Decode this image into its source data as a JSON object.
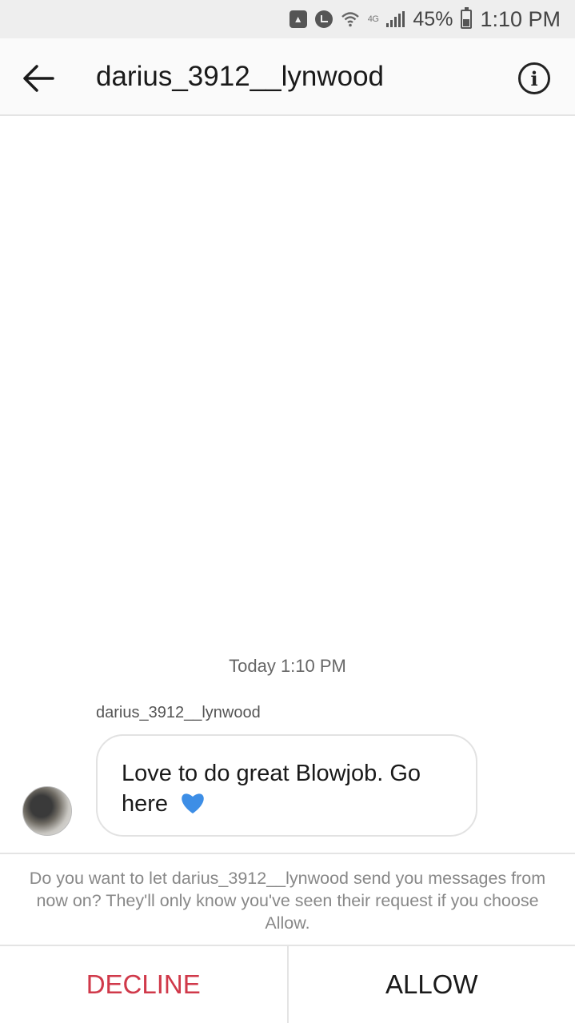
{
  "status_bar": {
    "lte_label": "4G",
    "battery_percent": "45%",
    "time": "1:10 PM",
    "icons": [
      "notification-icon",
      "alarm-icon",
      "wifi-icon",
      "signal-icon",
      "battery-icon"
    ]
  },
  "header": {
    "title": "darius_3912__lynwood",
    "back_icon": "arrow-left-icon",
    "info_icon": "info-icon"
  },
  "conversation": {
    "timestamp": "Today 1:10 PM",
    "sender": "darius_3912__lynwood",
    "message": {
      "text": "Love to do great Blowjob. Go here",
      "emoji": "blue-heart-icon"
    }
  },
  "request": {
    "prompt": "Do you want to let darius_3912__lynwood send you messages from now on? They'll only know you've seen their request if you choose Allow.",
    "decline_label": "DECLINE",
    "allow_label": "ALLOW"
  },
  "colors": {
    "decline": "#d0394a",
    "heart": "#3d8ee6",
    "status_bar_bg": "#eeeeee"
  }
}
